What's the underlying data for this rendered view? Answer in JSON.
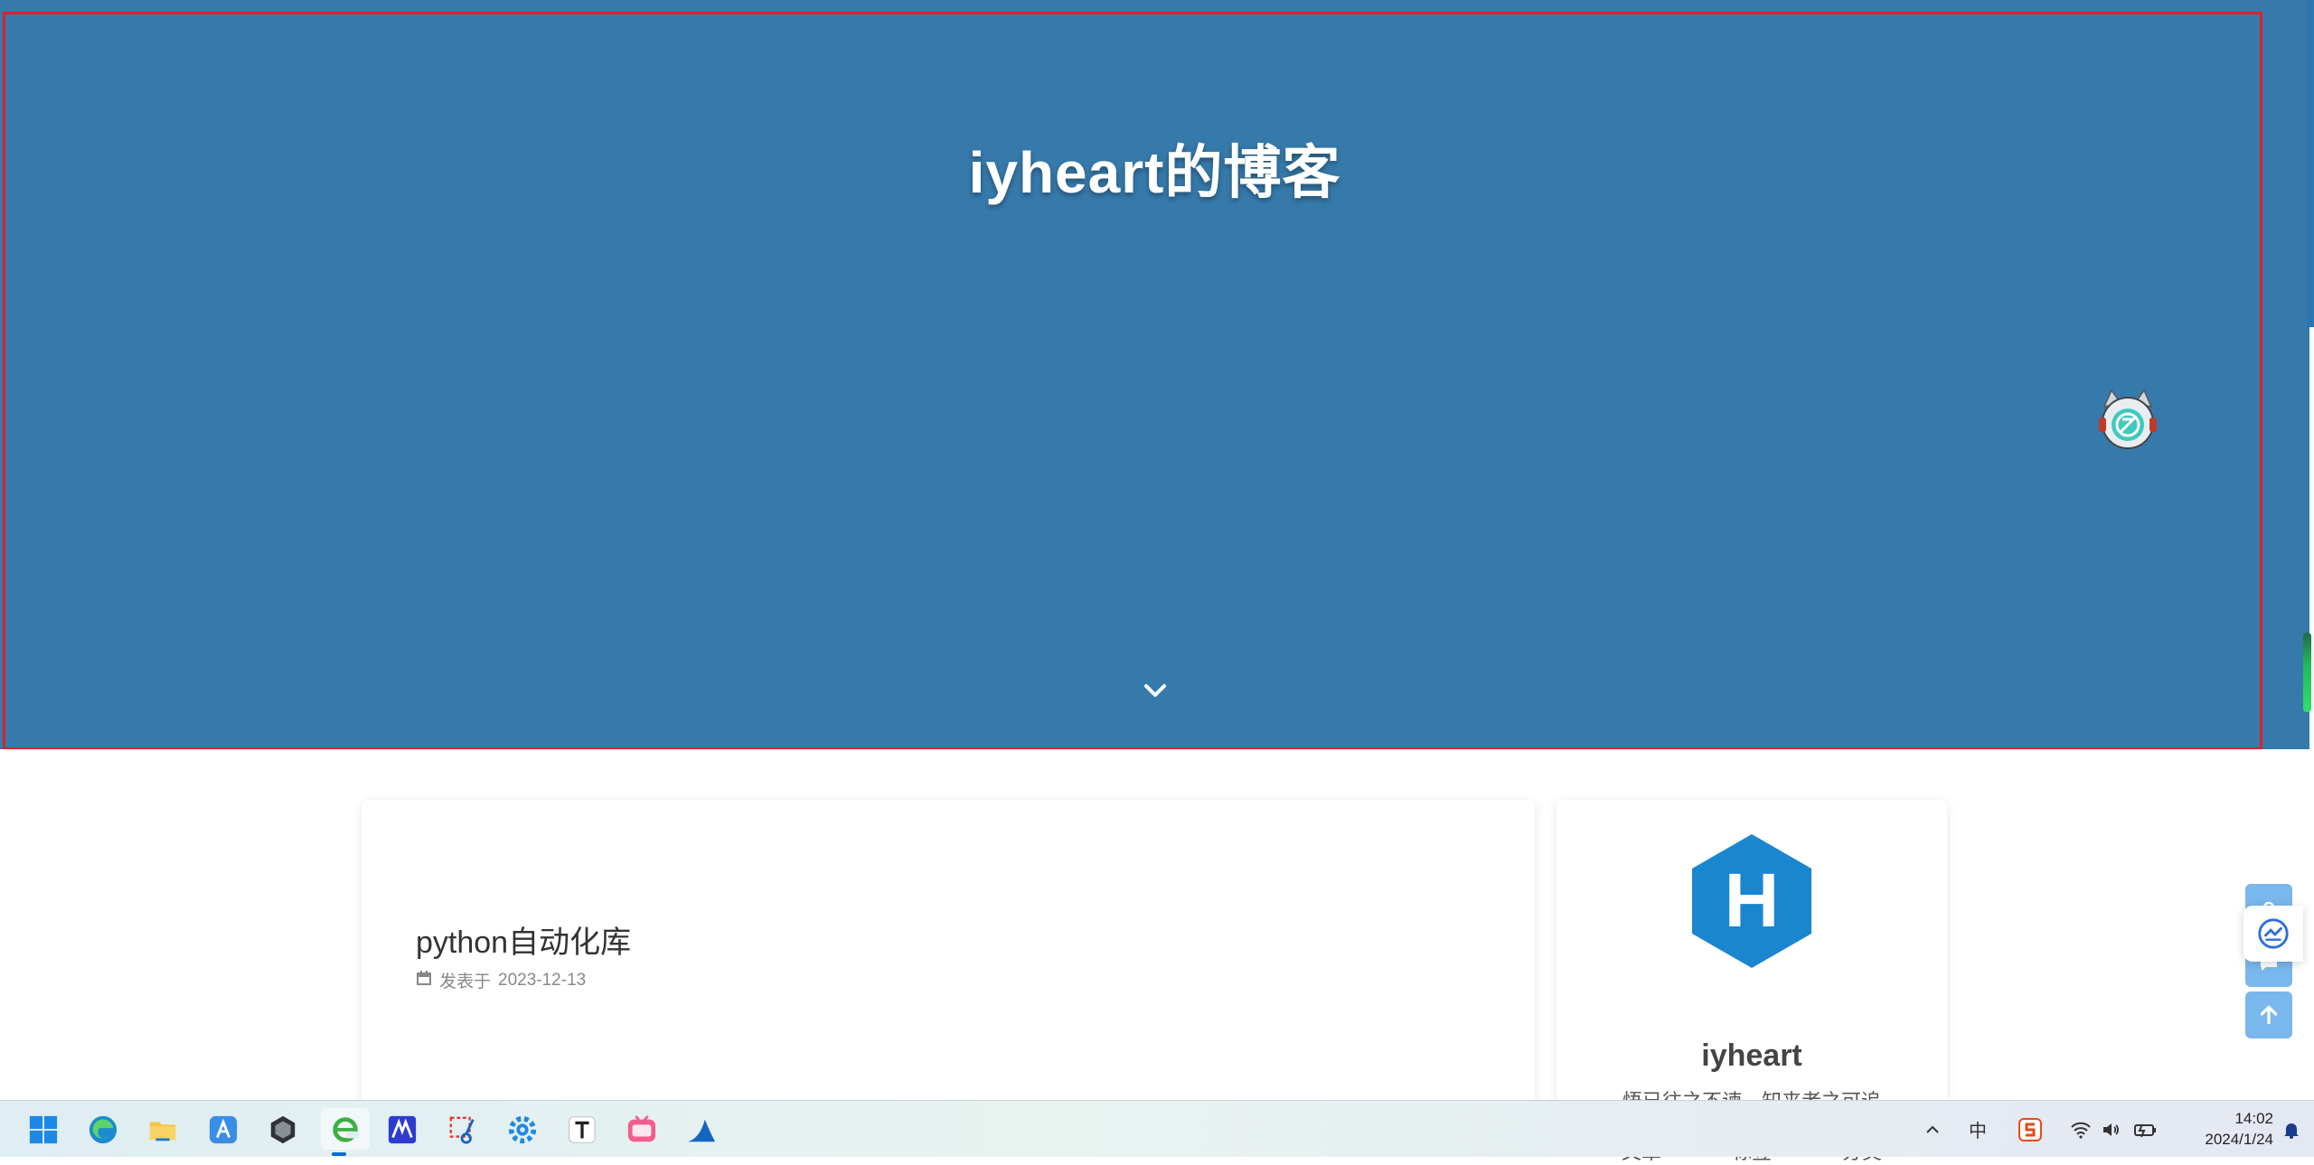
{
  "hero": {
    "site_title": "iyheart的博客"
  },
  "post": {
    "title": "python自动化库",
    "meta_label": "发表于",
    "date": "2023-12-13"
  },
  "sidebar": {
    "avatar_letter": "H",
    "author_name": "iyheart",
    "motto": "悟已往之不谏，知来者之可追",
    "stats": [
      "文章",
      "标签",
      "分类"
    ]
  },
  "taskbar": {
    "apps": [
      "windows-start",
      "edge-browser",
      "file-explorer",
      "app-a",
      "dark-cube-app",
      "ie-browser",
      "app-m",
      "snipping-tool",
      "settings-gear",
      "typora-t",
      "bilibili",
      "wireshark"
    ],
    "ime_label": "中",
    "time": "14:02",
    "date": "2024/1/24"
  },
  "colors": {
    "hero_bg": "#367aab",
    "highlight_outline": "#e0202a",
    "float_button": "#7ab7ec",
    "avatar_blue": "#1a86d0"
  }
}
